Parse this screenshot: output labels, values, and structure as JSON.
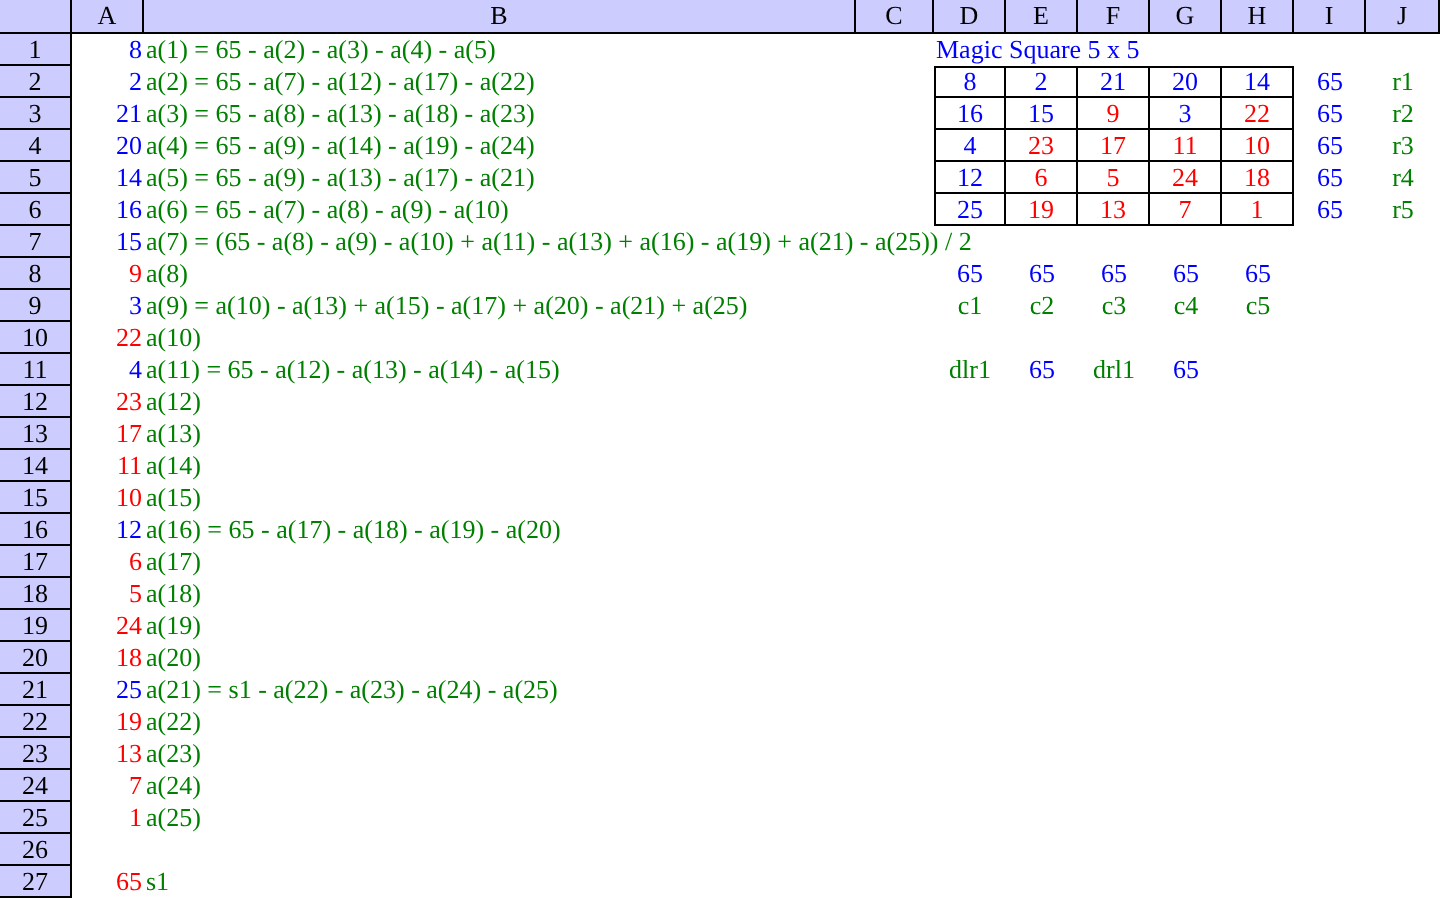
{
  "columns": [
    "A",
    "B",
    "C",
    "D",
    "E",
    "F",
    "G",
    "H",
    "I",
    "J"
  ],
  "rows": [
    {
      "number": "1",
      "a": {
        "text": "8",
        "color": "#0000ff"
      },
      "b": "a(1) = 65 - a(2) - a(3) - a(4) - a(5)"
    },
    {
      "number": "2",
      "a": {
        "text": "2",
        "color": "#0000ff"
      },
      "b": "a(2) = 65 - a(7) - a(12) - a(17) - a(22)"
    },
    {
      "number": "3",
      "a": {
        "text": "21",
        "color": "#0000ff"
      },
      "b": "a(3) = 65 - a(8) - a(13) - a(18) - a(23)"
    },
    {
      "number": "4",
      "a": {
        "text": "20",
        "color": "#0000ff"
      },
      "b": "a(4) = 65 - a(9) - a(14) - a(19) - a(24)"
    },
    {
      "number": "5",
      "a": {
        "text": "14",
        "color": "#0000ff"
      },
      "b": "a(5) = 65 - a(9) - a(13) - a(17) - a(21)"
    },
    {
      "number": "6",
      "a": {
        "text": "16",
        "color": "#0000ff"
      },
      "b": "a(6) = 65 - a(7) - a(8) - a(9) - a(10)"
    },
    {
      "number": "7",
      "a": {
        "text": "15",
        "color": "#0000ff"
      },
      "b": "a(7) = (65 - a(8) - a(9) - a(10) + a(11) - a(13) + a(16) - a(19) + a(21) - a(25)) / 2"
    },
    {
      "number": "8",
      "a": {
        "text": "9",
        "color": "#ff0000"
      },
      "b": "a(8)"
    },
    {
      "number": "9",
      "a": {
        "text": "3",
        "color": "#0000ff"
      },
      "b": "a(9) = a(10) - a(13) + a(15) - a(17) + a(20) - a(21) + a(25)"
    },
    {
      "number": "10",
      "a": {
        "text": "22",
        "color": "#ff0000"
      },
      "b": "a(10)"
    },
    {
      "number": "11",
      "a": {
        "text": "4",
        "color": "#0000ff"
      },
      "b": "a(11) = 65 - a(12) - a(13) - a(14) - a(15)"
    },
    {
      "number": "12",
      "a": {
        "text": "23",
        "color": "#ff0000"
      },
      "b": "a(12)"
    },
    {
      "number": "13",
      "a": {
        "text": "17",
        "color": "#ff0000"
      },
      "b": "a(13)"
    },
    {
      "number": "14",
      "a": {
        "text": "11",
        "color": "#ff0000"
      },
      "b": "a(14)"
    },
    {
      "number": "15",
      "a": {
        "text": "10",
        "color": "#ff0000"
      },
      "b": "a(15)"
    },
    {
      "number": "16",
      "a": {
        "text": "12",
        "color": "#0000ff"
      },
      "b": "a(16) = 65 - a(17) - a(18) - a(19) - a(20)"
    },
    {
      "number": "17",
      "a": {
        "text": "6",
        "color": "#ff0000"
      },
      "b": "a(17)"
    },
    {
      "number": "18",
      "a": {
        "text": "5",
        "color": "#ff0000"
      },
      "b": "a(18)"
    },
    {
      "number": "19",
      "a": {
        "text": "24",
        "color": "#ff0000"
      },
      "b": "a(19)"
    },
    {
      "number": "20",
      "a": {
        "text": "18",
        "color": "#ff0000"
      },
      "b": "a(20)"
    },
    {
      "number": "21",
      "a": {
        "text": "25",
        "color": "#0000ff"
      },
      "b": "a(21) = s1 - a(22) - a(23) - a(24) - a(25)"
    },
    {
      "number": "22",
      "a": {
        "text": "19",
        "color": "#ff0000"
      },
      "b": "a(22)"
    },
    {
      "number": "23",
      "a": {
        "text": "13",
        "color": "#ff0000"
      },
      "b": "a(23)"
    },
    {
      "number": "24",
      "a": {
        "text": "7",
        "color": "#ff0000"
      },
      "b": "a(24)"
    },
    {
      "number": "25",
      "a": {
        "text": "1",
        "color": "#ff0000"
      },
      "b": "a(25)"
    },
    {
      "number": "26"
    },
    {
      "number": "27",
      "a": {
        "text": "65",
        "color": "#ff0000"
      },
      "b": "s1"
    }
  ],
  "magic_square": {
    "title": "Magic Square 5 x 5",
    "grid": [
      [
        {
          "text": "8",
          "color": "#0000ff"
        },
        {
          "text": "2",
          "color": "#0000ff"
        },
        {
          "text": "21",
          "color": "#0000ff"
        },
        {
          "text": "20",
          "color": "#0000ff"
        },
        {
          "text": "14",
          "color": "#0000ff"
        }
      ],
      [
        {
          "text": "16",
          "color": "#0000ff"
        },
        {
          "text": "15",
          "color": "#0000ff"
        },
        {
          "text": "9",
          "color": "#ff0000"
        },
        {
          "text": "3",
          "color": "#0000ff"
        },
        {
          "text": "22",
          "color": "#ff0000"
        }
      ],
      [
        {
          "text": "4",
          "color": "#0000ff"
        },
        {
          "text": "23",
          "color": "#ff0000"
        },
        {
          "text": "17",
          "color": "#ff0000"
        },
        {
          "text": "11",
          "color": "#ff0000"
        },
        {
          "text": "10",
          "color": "#ff0000"
        }
      ],
      [
        {
          "text": "12",
          "color": "#0000ff"
        },
        {
          "text": "6",
          "color": "#ff0000"
        },
        {
          "text": "5",
          "color": "#ff0000"
        },
        {
          "text": "24",
          "color": "#ff0000"
        },
        {
          "text": "18",
          "color": "#ff0000"
        }
      ],
      [
        {
          "text": "25",
          "color": "#0000ff"
        },
        {
          "text": "19",
          "color": "#ff0000"
        },
        {
          "text": "13",
          "color": "#ff0000"
        },
        {
          "text": "7",
          "color": "#ff0000"
        },
        {
          "text": "1",
          "color": "#ff0000"
        }
      ]
    ],
    "row_sums": [
      {
        "value": "65",
        "label": "r1"
      },
      {
        "value": "65",
        "label": "r2"
      },
      {
        "value": "65",
        "label": "r3"
      },
      {
        "value": "65",
        "label": "r4"
      },
      {
        "value": "65",
        "label": "r5"
      }
    ],
    "column_sums": [
      {
        "value": "65",
        "label": "c1"
      },
      {
        "value": "65",
        "label": "c2"
      },
      {
        "value": "65",
        "label": "c3"
      },
      {
        "value": "65",
        "label": "c4"
      },
      {
        "value": "65",
        "label": "c5"
      }
    ],
    "diagonals": [
      {
        "kind": "label",
        "text": "dlr1"
      },
      {
        "kind": "value",
        "text": "65"
      },
      {
        "kind": "label",
        "text": "drl1"
      },
      {
        "kind": "value",
        "text": "65"
      }
    ]
  }
}
